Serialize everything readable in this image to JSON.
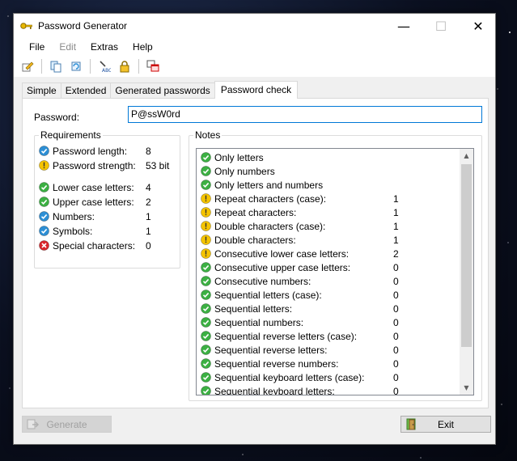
{
  "window": {
    "title": "Password Generator",
    "controls": {
      "minimize": "—",
      "maximize": "☐",
      "close": "✕"
    }
  },
  "menu": {
    "items": [
      "File",
      "Edit",
      "Extras",
      "Help"
    ]
  },
  "toolbar": {
    "icons": [
      "edit-icon",
      "copy-icon",
      "refresh-icon",
      "spellcheck-icon",
      "lock-icon",
      "windows-icon"
    ]
  },
  "tabs": [
    "Simple",
    "Extended",
    "Generated passwords",
    "Password check"
  ],
  "password": {
    "label": "Password:",
    "value": "P@ssW0rd"
  },
  "requirements": {
    "title": "Requirements",
    "rows": [
      {
        "label": "Password length:",
        "value": "8",
        "status": "info"
      },
      {
        "label": "Password strength:",
        "value": "53 bit",
        "status": "warning"
      },
      {
        "label": "Lower case letters:",
        "value": "4",
        "status": "ok"
      },
      {
        "label": "Upper case letters:",
        "value": "2",
        "status": "ok"
      },
      {
        "label": "Numbers:",
        "value": "1",
        "status": "info"
      },
      {
        "label": "Symbols:",
        "value": "1",
        "status": "info"
      },
      {
        "label": "Special characters:",
        "value": "0",
        "status": "error"
      }
    ]
  },
  "notes": {
    "title": "Notes",
    "rows": [
      {
        "label": "Only letters",
        "value": "",
        "status": "ok"
      },
      {
        "label": "Only numbers",
        "value": "",
        "status": "ok"
      },
      {
        "label": "Only letters and numbers",
        "value": "",
        "status": "ok"
      },
      {
        "label": "Repeat characters (case):",
        "value": "1",
        "status": "warning"
      },
      {
        "label": "Repeat characters:",
        "value": "1",
        "status": "warning"
      },
      {
        "label": "Double characters (case):",
        "value": "1",
        "status": "warning"
      },
      {
        "label": "Double characters:",
        "value": "1",
        "status": "warning"
      },
      {
        "label": "Consecutive lower case letters:",
        "value": "2",
        "status": "warning"
      },
      {
        "label": "Consecutive upper case letters:",
        "value": "0",
        "status": "ok"
      },
      {
        "label": "Consecutive numbers:",
        "value": "0",
        "status": "ok"
      },
      {
        "label": "Sequential letters (case):",
        "value": "0",
        "status": "ok"
      },
      {
        "label": "Sequential letters:",
        "value": "0",
        "status": "ok"
      },
      {
        "label": "Sequential numbers:",
        "value": "0",
        "status": "ok"
      },
      {
        "label": "Sequential reverse letters (case):",
        "value": "0",
        "status": "ok"
      },
      {
        "label": "Sequential reverse letters:",
        "value": "0",
        "status": "ok"
      },
      {
        "label": "Sequential reverse numbers:",
        "value": "0",
        "status": "ok"
      },
      {
        "label": "Sequential keyboard letters (case):",
        "value": "0",
        "status": "ok"
      },
      {
        "label": "Sequential keyboard letters:",
        "value": "0",
        "status": "ok"
      }
    ]
  },
  "buttons": {
    "generate": "Generate",
    "exit": "Exit"
  },
  "colors": {
    "ok": "#3cb043",
    "warning": "#f5c400",
    "info": "#2d8fd5",
    "error": "#d9262c",
    "accent": "#0078d7"
  }
}
